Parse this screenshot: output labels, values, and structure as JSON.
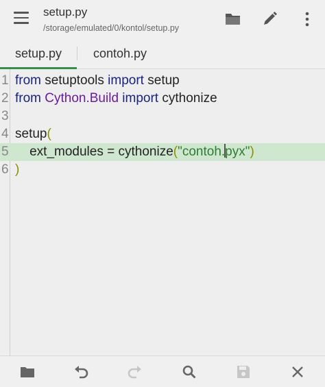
{
  "appbar": {
    "title": "setup.py",
    "path": "/storage/emulated/0/kontol/setup.py",
    "icons": [
      "menu-icon",
      "folder-open-icon",
      "edit-pencil-icon",
      "more-vert-icon"
    ]
  },
  "tabs": [
    {
      "label": "setup.py",
      "active": true
    },
    {
      "label": "contoh.py",
      "active": false
    }
  ],
  "editor": {
    "lines": [
      {
        "n": "1",
        "tokens": [
          {
            "t": "from",
            "c": "kw"
          },
          {
            "t": " setuptools ",
            "c": ""
          },
          {
            "t": "import",
            "c": "kw"
          },
          {
            "t": " setup",
            "c": ""
          }
        ]
      },
      {
        "n": "2",
        "tokens": [
          {
            "t": "from",
            "c": "kw"
          },
          {
            "t": " ",
            "c": ""
          },
          {
            "t": "Cython.Build",
            "c": "mod"
          },
          {
            "t": " ",
            "c": ""
          },
          {
            "t": "import",
            "c": "kw"
          },
          {
            "t": " cythonize",
            "c": ""
          }
        ]
      },
      {
        "n": "3",
        "tokens": []
      },
      {
        "n": "4",
        "tokens": [
          {
            "t": "setup",
            "c": ""
          },
          {
            "t": "(",
            "c": "par"
          }
        ]
      },
      {
        "n": "5",
        "highlight": true,
        "tokens": [
          {
            "t": "    ext_modules = cythonize",
            "c": ""
          },
          {
            "t": "(",
            "c": "par"
          },
          {
            "t": "\"contoh.",
            "c": "str"
          },
          {
            "t": "|",
            "c": "cursor"
          },
          {
            "t": "pyx\"",
            "c": "str"
          },
          {
            "t": ")",
            "c": "par"
          }
        ]
      },
      {
        "n": "6",
        "tokens": [
          {
            "t": ")",
            "c": "par"
          }
        ]
      }
    ]
  },
  "bottombar": {
    "icons": [
      "open-folder-icon",
      "undo-icon",
      "redo-icon",
      "search-icon",
      "save-icon",
      "close-icon"
    ],
    "disabled": [
      "redo-icon",
      "save-icon"
    ]
  },
  "colors": {
    "accent": "#3a8c4e",
    "highlight_line": "#cfe6cf",
    "keyword": "#1a237e",
    "module": "#6a1b9a",
    "string": "#2e7d32",
    "paren": "#8d8d00"
  }
}
